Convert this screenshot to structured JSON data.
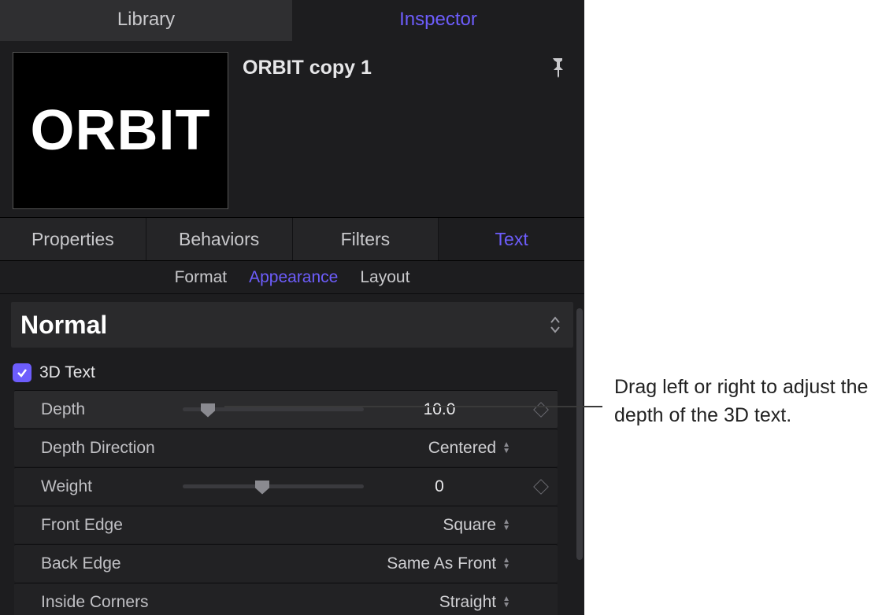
{
  "topTabs": {
    "library": "Library",
    "inspector": "Inspector"
  },
  "header": {
    "thumbText": "ORBIT",
    "title": "ORBIT copy 1"
  },
  "midTabs": {
    "properties": "Properties",
    "behaviors": "Behaviors",
    "filters": "Filters",
    "text": "Text"
  },
  "subTabs": {
    "format": "Format",
    "appearance": "Appearance",
    "layout": "Layout"
  },
  "styleMenu": {
    "value": "Normal"
  },
  "section3d": {
    "checkboxLabel": "3D Text",
    "checked": true,
    "params": {
      "depth": {
        "label": "Depth",
        "value": "10.0",
        "sliderPercent": 10
      },
      "depthDirection": {
        "label": "Depth Direction",
        "value": "Centered"
      },
      "weight": {
        "label": "Weight",
        "value": "0",
        "sliderPercent": 40
      },
      "frontEdge": {
        "label": "Front Edge",
        "value": "Square"
      },
      "backEdge": {
        "label": "Back Edge",
        "value": "Same As Front"
      },
      "insideCorners": {
        "label": "Inside Corners",
        "value": "Straight"
      }
    }
  },
  "callout": "Drag left or right to adjust the depth of the 3D text."
}
